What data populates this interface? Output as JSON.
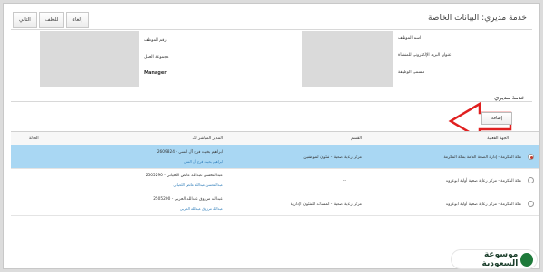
{
  "title": "خدمة مديري: البيانات الخاصة",
  "toolbar": {
    "next": "التالي",
    "back": "للخلف",
    "cancel": "إلغاء"
  },
  "info": {
    "employee_number_label": "رقم الموظف",
    "employee_name_label": "اسم الموظف",
    "work_group_label": "مجموعة العمل",
    "email_label": "عنوان البريد الإلكتروني للمنشأة",
    "job_title_label": "مسمى الوظيفة",
    "work_group_value": "Manager"
  },
  "section_title": "خدمة مديري",
  "add_button": "إضافة",
  "table": {
    "headers": {
      "entity": "الجهة الفعلية",
      "department": "القسم",
      "manager": "المدير المباشر لك",
      "status": "الحالة"
    },
    "rows": [
      {
        "entity": "مكة المكرمة - إدارة الصحة العامة بمكة المكرمة",
        "department": "مركز رعاية صحية - شئون الموظفين",
        "manager": "2609824 - ابراهيم بخيت فرج آل السي",
        "manager_sub": "ابراهيم بخيت فرج آل السي",
        "status": "",
        "selected": true
      },
      {
        "entity": "مكة المكرمة - مركز رعاية صحية أولية ابوعروه",
        "department": "--",
        "manager": "2505290 - عبدالمحسن عبدالله عائض اللحياني",
        "manager_sub": "عبدالمحسن عبدالله عائض اللحياني",
        "status": "",
        "selected": false
      },
      {
        "entity": "مكة المكرمة - مركز رعاية صحية أولية ابوعروه",
        "department": "مركز رعاية صحية - المساعد للشئون الإدارية",
        "manager": "2505200 - عبدالله مرزوق عبدالله الحربي",
        "manager_sub": "عبدالله مرزوق عبدالله الحربي",
        "status": "",
        "selected": false
      }
    ]
  },
  "watermark": "موسوعة السعودية",
  "colors": {
    "selected_row": "#a9d7f3",
    "arrow": "#e02020",
    "link": "#2a7ab8"
  }
}
